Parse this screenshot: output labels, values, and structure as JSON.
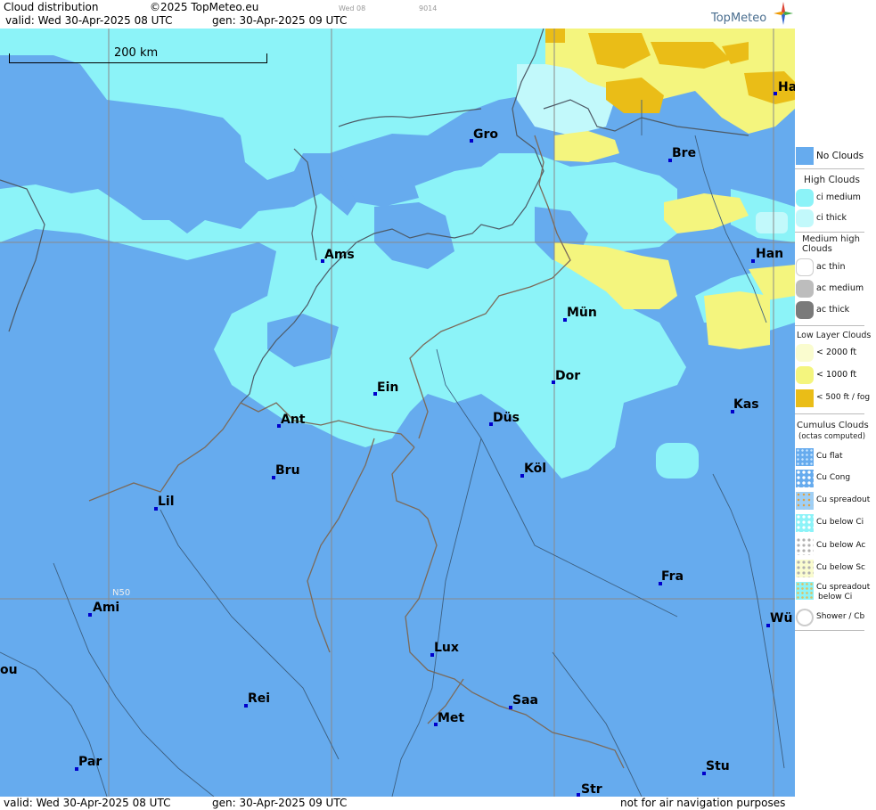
{
  "header": {
    "title": "Cloud distribution",
    "copyright": "©2025 TopMeteo.eu",
    "valid": "valid:  Wed  30-Apr-2025  08 UTC",
    "generated": "gen: 30-Apr-2025 09 UTC",
    "small_day": "Wed 08",
    "small_code": "9014",
    "brand": "TopMeteo"
  },
  "map": {
    "scale_label": "200 km",
    "grid_label": "N50",
    "cities": {
      "gro": "Gro",
      "bre": "Bre",
      "ha": "Ha",
      "ams": "Ams",
      "han": "Han",
      "mun": "Mün",
      "dor": "Dor",
      "ein": "Ein",
      "ant": "Ant",
      "dus": "Düs",
      "kas": "Kas",
      "bru": "Bru",
      "kol": "Köl",
      "lil": "Lil",
      "fra": "Fra",
      "ami": "Ami",
      "wu": "Wü",
      "lux": "Lux",
      "ou": "ou",
      "rei": "Rei",
      "saa": "Saa",
      "met": "Met",
      "par": "Par",
      "stu": "Stu",
      "str": "Str"
    },
    "colors": {
      "no_clouds": "#66abee",
      "ci_medium": "#8cf3f8",
      "ci_thick": "#c2f9fb",
      "low_1000": "#f4f57e",
      "low_500": "#eabd17"
    }
  },
  "footer": {
    "valid": "valid:  Wed  30-Apr-2025  08 UTC",
    "generated": "gen: 30-Apr-2025 09 UTC",
    "disclaimer": "not for air navigation purposes"
  },
  "legend": {
    "no_clouds": "No Clouds",
    "high_title": "High Clouds",
    "ci_medium": "ci medium",
    "ci_thick": "ci thick",
    "medium_title": "Medium high Clouds",
    "ac_thin": "ac thin",
    "ac_medium": "ac medium",
    "ac_thick": "ac thick",
    "low_title": "Low Layer Clouds",
    "low_2000": "< 2000 ft",
    "low_1000": "< 1000 ft",
    "low_500": "< 500 ft / fog",
    "cumulus_title": "Cumulus Clouds",
    "cumulus_sub": "(octas computed)",
    "cu_flat": "Cu flat",
    "cu_cong": "Cu Cong",
    "cu_spreadout": "Cu spreadout",
    "cu_below_ci": "Cu below Ci",
    "cu_below_ac": "Cu below Ac",
    "cu_below_sc": "Cu below Sc",
    "cu_spreadout_below_ci_1": "Cu spreadout",
    "cu_spreadout_below_ci_2": "below Ci",
    "shower": "Shower / Cb"
  }
}
